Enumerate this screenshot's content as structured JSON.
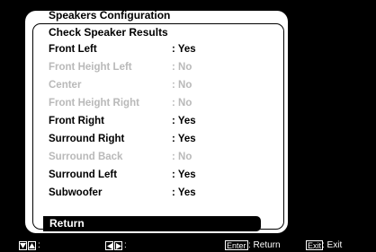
{
  "screen": {
    "title": "Speakers Configuration",
    "section_title": "Check Speaker Results"
  },
  "speakers": [
    {
      "name": "Front Left",
      "value": ": Yes",
      "active": true
    },
    {
      "name": "Front Height Left",
      "value": ": No",
      "active": false
    },
    {
      "name": "Center",
      "value": ": No",
      "active": false
    },
    {
      "name": "Front Height Right",
      "value": ": No",
      "active": false
    },
    {
      "name": "Front Right",
      "value": ": Yes",
      "active": true
    },
    {
      "name": "Surround Right",
      "value": ": Yes",
      "active": true
    },
    {
      "name": "Surround Back",
      "value": ": No",
      "active": false
    },
    {
      "name": "Surround Left",
      "value": ": Yes",
      "active": true
    },
    {
      "name": "Subwoofer",
      "value": ": Yes",
      "active": true
    }
  ],
  "return_button": {
    "label": "Return"
  },
  "hint_bar": {
    "updown_colon": ":",
    "leftright_colon": ":",
    "enter_key": "Enter",
    "enter_action": ": Return",
    "exit_key": "Exit",
    "exit_action": ": Exit",
    "icons": [
      "down-arrow-icon",
      "up-arrow-icon",
      "left-arrow-icon",
      "right-arrow-icon"
    ]
  },
  "colors": {
    "background": "#000000",
    "panel": "#ffffff",
    "active_text": "#000000",
    "inactive_text": "#b9b9b9"
  }
}
